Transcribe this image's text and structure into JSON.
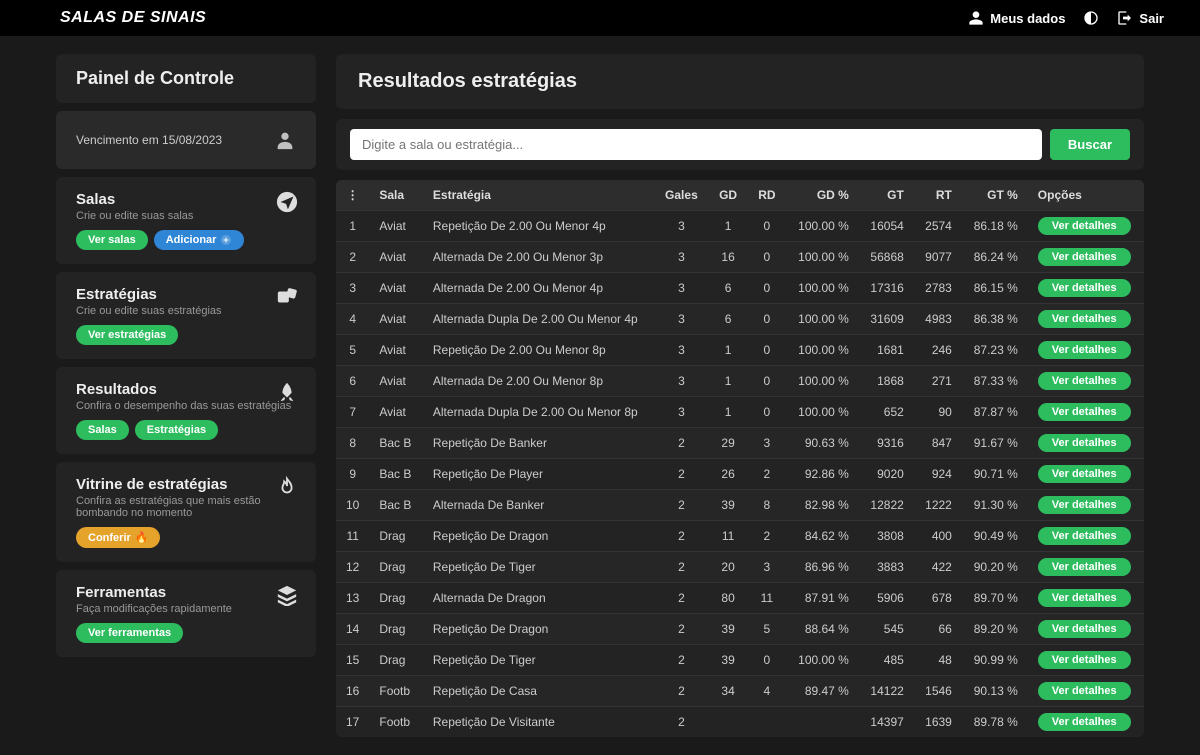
{
  "brand": "SALAS DE SINAIS",
  "topbar": {
    "my_data": "Meus dados",
    "logout": "Sair"
  },
  "sidebar": {
    "panel_title": "Painel de Controle",
    "expiry": "Vencimento em 15/08/2023",
    "sections": {
      "salas": {
        "title": "Salas",
        "desc": "Crie ou edite suas salas",
        "btn_view": "Ver salas",
        "btn_add": "Adicionar"
      },
      "estrategias": {
        "title": "Estratégias",
        "desc": "Crie ou edite suas estratégias",
        "btn_view": "Ver estratégias"
      },
      "resultados": {
        "title": "Resultados",
        "desc": "Confira o desempenho das suas estratégias",
        "btn_salas": "Salas",
        "btn_estr": "Estratégias"
      },
      "vitrine": {
        "title": "Vitrine de estratégias",
        "desc": "Confira as estratégias que mais estão bombando no momento",
        "btn": "Conferir"
      },
      "ferramentas": {
        "title": "Ferramentas",
        "desc": "Faça modificações rapidamente",
        "btn": "Ver ferramentas"
      }
    }
  },
  "main": {
    "title": "Resultados estratégias",
    "search_placeholder": "Digite a sala ou estratégia...",
    "search_btn": "Buscar"
  },
  "table": {
    "headers": {
      "sala": "Sala",
      "estrategia": "Estratégia",
      "gales": "Gales",
      "gd": "GD",
      "rd": "RD",
      "gdp": "GD %",
      "gt": "GT",
      "rt": "RT",
      "gtp": "GT %",
      "options": "Opções"
    },
    "detail_label": "Ver detalhes",
    "rows": [
      {
        "idx": 1,
        "sala": "Aviat",
        "estrategia": "Repetição De 2.00 Ou Menor 4p",
        "gales": 3,
        "gd": 1,
        "rd": 0,
        "gdp": "100.00 %",
        "gt": 16054,
        "rt": 2574,
        "gtp": "86.18 %"
      },
      {
        "idx": 2,
        "sala": "Aviat",
        "estrategia": "Alternada De 2.00 Ou Menor 3p",
        "gales": 3,
        "gd": 16,
        "rd": 0,
        "gdp": "100.00 %",
        "gt": 56868,
        "rt": 9077,
        "gtp": "86.24 %"
      },
      {
        "idx": 3,
        "sala": "Aviat",
        "estrategia": "Alternada De 2.00 Ou Menor 4p",
        "gales": 3,
        "gd": 6,
        "rd": 0,
        "gdp": "100.00 %",
        "gt": 17316,
        "rt": 2783,
        "gtp": "86.15 %"
      },
      {
        "idx": 4,
        "sala": "Aviat",
        "estrategia": "Alternada Dupla De 2.00 Ou Menor 4p",
        "gales": 3,
        "gd": 6,
        "rd": 0,
        "gdp": "100.00 %",
        "gt": 31609,
        "rt": 4983,
        "gtp": "86.38 %"
      },
      {
        "idx": 5,
        "sala": "Aviat",
        "estrategia": "Repetição De 2.00 Ou Menor 8p",
        "gales": 3,
        "gd": 1,
        "rd": 0,
        "gdp": "100.00 %",
        "gt": 1681,
        "rt": 246,
        "gtp": "87.23 %"
      },
      {
        "idx": 6,
        "sala": "Aviat",
        "estrategia": "Alternada De 2.00 Ou Menor 8p",
        "gales": 3,
        "gd": 1,
        "rd": 0,
        "gdp": "100.00 %",
        "gt": 1868,
        "rt": 271,
        "gtp": "87.33 %"
      },
      {
        "idx": 7,
        "sala": "Aviat",
        "estrategia": "Alternada Dupla De 2.00 Ou Menor 8p",
        "gales": 3,
        "gd": 1,
        "rd": 0,
        "gdp": "100.00 %",
        "gt": 652,
        "rt": 90,
        "gtp": "87.87 %"
      },
      {
        "idx": 8,
        "sala": "Bac B",
        "estrategia": "Repetição De Banker",
        "gales": 2,
        "gd": 29,
        "rd": 3,
        "gdp": "90.63 %",
        "gt": 9316,
        "rt": 847,
        "gtp": "91.67 %"
      },
      {
        "idx": 9,
        "sala": "Bac B",
        "estrategia": "Repetição De Player",
        "gales": 2,
        "gd": 26,
        "rd": 2,
        "gdp": "92.86 %",
        "gt": 9020,
        "rt": 924,
        "gtp": "90.71 %"
      },
      {
        "idx": 10,
        "sala": "Bac B",
        "estrategia": "Alternada De Banker",
        "gales": 2,
        "gd": 39,
        "rd": 8,
        "gdp": "82.98 %",
        "gt": 12822,
        "rt": 1222,
        "gtp": "91.30 %"
      },
      {
        "idx": 11,
        "sala": "Drag",
        "estrategia": "Repetição De Dragon",
        "gales": 2,
        "gd": 11,
        "rd": 2,
        "gdp": "84.62 %",
        "gt": 3808,
        "rt": 400,
        "gtp": "90.49 %"
      },
      {
        "idx": 12,
        "sala": "Drag",
        "estrategia": "Repetição De Tiger",
        "gales": 2,
        "gd": 20,
        "rd": 3,
        "gdp": "86.96 %",
        "gt": 3883,
        "rt": 422,
        "gtp": "90.20 %"
      },
      {
        "idx": 13,
        "sala": "Drag",
        "estrategia": "Alternada De Dragon",
        "gales": 2,
        "gd": 80,
        "rd": 11,
        "gdp": "87.91 %",
        "gt": 5906,
        "rt": 678,
        "gtp": "89.70 %"
      },
      {
        "idx": 14,
        "sala": "Drag",
        "estrategia": "Repetição De Dragon",
        "gales": 2,
        "gd": 39,
        "rd": 5,
        "gdp": "88.64 %",
        "gt": 545,
        "rt": 66,
        "gtp": "89.20 %"
      },
      {
        "idx": 15,
        "sala": "Drag",
        "estrategia": "Repetição De Tiger",
        "gales": 2,
        "gd": 39,
        "rd": 0,
        "gdp": "100.00 %",
        "gt": 485,
        "rt": 48,
        "gtp": "90.99 %"
      },
      {
        "idx": 16,
        "sala": "Footb",
        "estrategia": "Repetição De Casa",
        "gales": 2,
        "gd": 34,
        "rd": 4,
        "gdp": "89.47 %",
        "gt": 14122,
        "rt": 1546,
        "gtp": "90.13 %"
      },
      {
        "idx": 17,
        "sala": "Footb",
        "estrategia": "Repetição De Visitante",
        "gales": 2,
        "gd": "",
        "rd": "",
        "gdp": "",
        "gt": 14397,
        "rt": 1639,
        "gtp": "89.78 %"
      }
    ]
  }
}
